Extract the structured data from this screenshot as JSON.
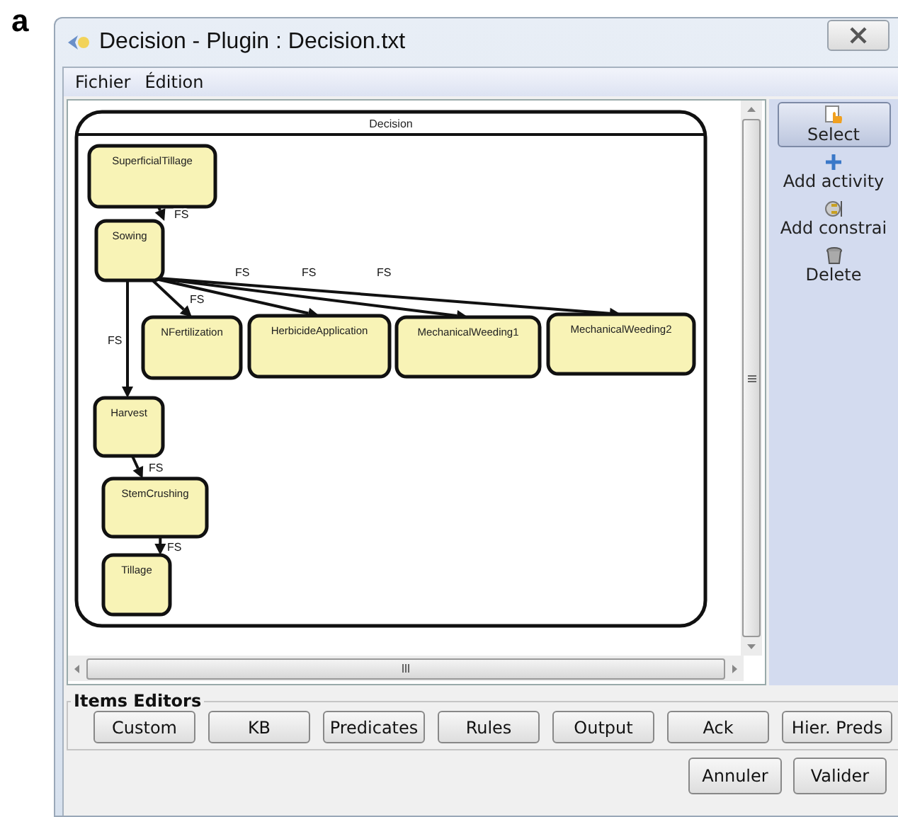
{
  "panel_label": "a",
  "window": {
    "title": "Decision - Plugin : Decision.txt"
  },
  "menu": [
    "Fichier",
    "Édition"
  ],
  "diagram": {
    "title": "Decision",
    "nodes": [
      "SuperficialTillage",
      "Sowing",
      "NFertilization",
      "HerbicideApplication",
      "MechanicalWeeding1",
      "MechanicalWeeding2",
      "Harvest",
      "StemCrushing",
      "Tillage"
    ],
    "edges": [
      {
        "label": "FS"
      },
      {
        "label": "FS"
      },
      {
        "label": "FS"
      },
      {
        "label": "FS"
      },
      {
        "label": "FS"
      },
      {
        "label": "FS"
      },
      {
        "label": "FS"
      },
      {
        "label": "FS"
      }
    ]
  },
  "tools": [
    {
      "kind": "select",
      "label": "Select",
      "selected": true
    },
    {
      "kind": "add",
      "label": "Add activity",
      "selected": false
    },
    {
      "kind": "plug",
      "label": "Add constrai",
      "selected": false
    },
    {
      "kind": "delete",
      "label": "Delete",
      "selected": false
    }
  ],
  "items_editors": {
    "title": "Items Editors",
    "buttons": [
      "Custom",
      "KB",
      "Predicates",
      "Rules",
      "Output",
      "Ack",
      "Hier. Preds"
    ]
  },
  "dialog_buttons": [
    "Annuler",
    "Valider"
  ]
}
